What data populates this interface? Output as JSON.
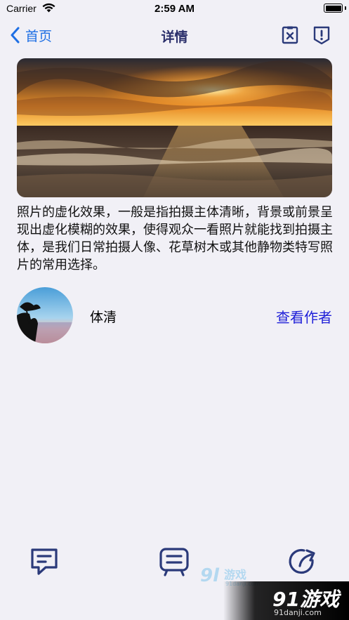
{
  "status_bar": {
    "carrier": "Carrier",
    "time": "2:59 AM",
    "icons": [
      "wifi-icon",
      "battery-icon"
    ]
  },
  "nav": {
    "back_label": "首页",
    "title": "详情",
    "icons": [
      "chevron-left-icon",
      "clipboard-x-icon",
      "report-icon"
    ]
  },
  "article": {
    "description": "照片的虚化效果，一般是指拍摄主体清晰，背景或前景呈现出虚化模糊的效果，使得观众一看照片就能找到拍摄主体，是我们日常拍摄人像、花草树木或其他静物类特写照片的常用选择。"
  },
  "author": {
    "name": "体清",
    "view_label": "查看作者"
  },
  "bottom_bar": {
    "icons": [
      "comment-icon",
      "message-board-icon",
      "share-icon"
    ]
  },
  "watermark": {
    "brand": "91游戏",
    "domain": "91danji.com"
  },
  "colors": {
    "background": "#f1f0f6",
    "accent_blue": "#1e6fe4",
    "nav_title": "#2b2f6b",
    "icon_navy": "#2b3a7a",
    "link": "#1f1fd8"
  }
}
